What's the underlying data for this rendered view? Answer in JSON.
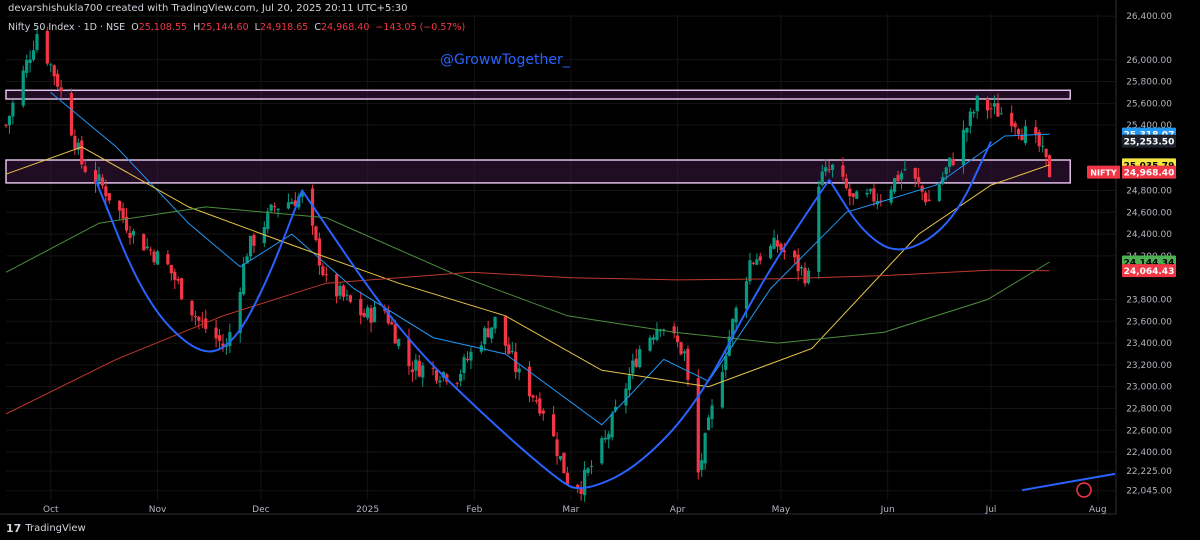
{
  "header": {
    "created_by": "devarshishukla700 created with TradingView.com, Jul 20, 2025 20:11 UTC+5:30"
  },
  "info": {
    "symbol": "Nifty 50 Index · 1D · NSE",
    "open_label": "O",
    "open": "25,108.55",
    "high_label": "H",
    "high": "25,144.60",
    "low_label": "L",
    "low": "24,918.65",
    "close_label": "C",
    "close": "24,968.40",
    "change": "−143.05 (−0.57%)"
  },
  "watermark": "@GrowwTogether_",
  "footer": {
    "logo_text": "TradingView",
    "logo_mark": "𝟭𝟳"
  },
  "colors": {
    "background": "#000000",
    "up": "#089981",
    "down": "#f23645",
    "zone_fill": "#3b1740",
    "zone_border": "#e1bee7",
    "ema_blue": "#2196f3",
    "ema_yellow": "#e8c547",
    "sma_green": "#4c8f3d",
    "sma_red": "#c0392b",
    "pattern_line": "#2962ff"
  },
  "chart_data": {
    "type": "candlestick",
    "y_range": [
      21960,
      26420
    ],
    "x_range": [
      "2024-09-18",
      "2025-08-06"
    ],
    "y_ticks": [
      "26,400.00",
      "26,000.00",
      "25,800.00",
      "25,600.00",
      "25,400.00",
      "24,800.00",
      "24,600.00",
      "24,400.00",
      "24,200.00",
      "23,800.00",
      "23,600.00",
      "23,400.00",
      "23,200.00",
      "23,000.00",
      "22,800.00",
      "22,600.00",
      "22,400.00",
      "22,225.00",
      "22,045.00"
    ],
    "y_tick_values": [
      26400,
      26000,
      25800,
      25600,
      25400,
      24800,
      24600,
      24400,
      24200,
      23800,
      23600,
      23400,
      23200,
      23000,
      22800,
      22600,
      22400,
      22225,
      22045
    ],
    "x_ticks": [
      {
        "label": "Oct",
        "date": "2024-10-01"
      },
      {
        "label": "Nov",
        "date": "2024-11-01"
      },
      {
        "label": "Dec",
        "date": "2024-12-01"
      },
      {
        "label": "2025",
        "date": "2025-01-01"
      },
      {
        "label": "Feb",
        "date": "2025-02-01"
      },
      {
        "label": "Mar",
        "date": "2025-03-01"
      },
      {
        "label": "Apr",
        "date": "2025-04-01"
      },
      {
        "label": "May",
        "date": "2025-05-01"
      },
      {
        "label": "Jun",
        "date": "2025-06-01"
      },
      {
        "label": "Jul",
        "date": "2025-07-01"
      },
      {
        "label": "Aug",
        "date": "2025-08-01"
      }
    ],
    "anchors": [
      [
        "2024-09-18",
        25400
      ],
      [
        "2024-09-27",
        26250
      ],
      [
        "2024-10-03",
        25800
      ],
      [
        "2024-10-10",
        25050
      ],
      [
        "2024-10-17",
        24800
      ],
      [
        "2024-10-25",
        24400
      ],
      [
        "2024-11-04",
        24100
      ],
      [
        "2024-11-13",
        23600
      ],
      [
        "2024-11-21",
        23350
      ],
      [
        "2024-11-27",
        24250
      ],
      [
        "2024-12-05",
        24650
      ],
      [
        "2024-12-13",
        24750
      ],
      [
        "2024-12-20",
        23950
      ],
      [
        "2024-12-31",
        23650
      ],
      [
        "2025-01-06",
        23700
      ],
      [
        "2025-01-13",
        23200
      ],
      [
        "2025-01-27",
        23100
      ],
      [
        "2025-02-03",
        23450
      ],
      [
        "2025-02-07",
        23600
      ],
      [
        "2025-02-14",
        23100
      ],
      [
        "2025-02-21",
        22800
      ],
      [
        "2025-02-28",
        22150
      ],
      [
        "2025-03-04",
        22100
      ],
      [
        "2025-03-11",
        22500
      ],
      [
        "2025-03-21",
        23350
      ],
      [
        "2025-03-27",
        23600
      ],
      [
        "2025-04-03",
        23300
      ],
      [
        "2025-04-07",
        22200
      ],
      [
        "2025-04-15",
        23350
      ],
      [
        "2025-04-22",
        24150
      ],
      [
        "2025-04-30",
        24300
      ],
      [
        "2025-05-09",
        24000
      ],
      [
        "2025-05-12",
        24900
      ],
      [
        "2025-05-16",
        25000
      ],
      [
        "2025-05-22",
        24700
      ],
      [
        "2025-05-30",
        24750
      ],
      [
        "2025-06-06",
        25000
      ],
      [
        "2025-06-13",
        24700
      ],
      [
        "2025-06-20",
        25100
      ],
      [
        "2025-06-27",
        25600
      ],
      [
        "2025-07-01",
        25550
      ],
      [
        "2025-07-07",
        25480
      ],
      [
        "2025-07-10",
        25350
      ],
      [
        "2025-07-15",
        25200
      ],
      [
        "2025-07-18",
        24968
      ]
    ],
    "zones": [
      {
        "y_top": 25720,
        "y_bottom": 25640,
        "from": "2024-09-18",
        "to": "2025-07-24"
      },
      {
        "y_top": 25080,
        "y_bottom": 24870,
        "from": "2024-09-18",
        "to": "2025-07-24"
      }
    ],
    "moving_averages": [
      {
        "color": "ema_blue",
        "points": [
          [
            "2024-10-01",
            25700
          ],
          [
            "2024-10-20",
            25200
          ],
          [
            "2024-11-10",
            24500
          ],
          [
            "2024-11-25",
            24100
          ],
          [
            "2024-12-10",
            24400
          ],
          [
            "2024-12-28",
            23900
          ],
          [
            "2025-01-20",
            23450
          ],
          [
            "2025-02-10",
            23300
          ],
          [
            "2025-03-10",
            22650
          ],
          [
            "2025-03-28",
            23250
          ],
          [
            "2025-04-10",
            23050
          ],
          [
            "2025-04-28",
            23900
          ],
          [
            "2025-05-20",
            24600
          ],
          [
            "2025-06-15",
            24850
          ],
          [
            "2025-07-05",
            25300
          ],
          [
            "2025-07-18",
            25318.07
          ]
        ]
      },
      {
        "color": "ema_yellow",
        "points": [
          [
            "2024-09-18",
            24950
          ],
          [
            "2024-10-10",
            25200
          ],
          [
            "2024-11-10",
            24650
          ],
          [
            "2024-12-10",
            24300
          ],
          [
            "2025-01-10",
            23950
          ],
          [
            "2025-02-10",
            23650
          ],
          [
            "2025-03-10",
            23150
          ],
          [
            "2025-04-10",
            23000
          ],
          [
            "2025-05-10",
            23350
          ],
          [
            "2025-06-10",
            24400
          ],
          [
            "2025-07-01",
            24850
          ],
          [
            "2025-07-18",
            25035.79
          ]
        ]
      },
      {
        "color": "sma_green",
        "points": [
          [
            "2024-09-18",
            24050
          ],
          [
            "2024-10-15",
            24500
          ],
          [
            "2024-11-15",
            24650
          ],
          [
            "2024-12-20",
            24550
          ],
          [
            "2025-01-25",
            24050
          ],
          [
            "2025-02-28",
            23650
          ],
          [
            "2025-03-31",
            23500
          ],
          [
            "2025-04-30",
            23400
          ],
          [
            "2025-05-31",
            23500
          ],
          [
            "2025-06-30",
            23800
          ],
          [
            "2025-07-18",
            24144.34
          ]
        ]
      },
      {
        "color": "sma_red",
        "points": [
          [
            "2024-09-18",
            22750
          ],
          [
            "2024-10-20",
            23250
          ],
          [
            "2024-11-20",
            23650
          ],
          [
            "2024-12-20",
            23950
          ],
          [
            "2025-01-31",
            24050
          ],
          [
            "2025-03-01",
            24000
          ],
          [
            "2025-04-01",
            23980
          ],
          [
            "2025-05-01",
            23990
          ],
          [
            "2025-06-01",
            24020
          ],
          [
            "2025-07-01",
            24070
          ],
          [
            "2025-07-18",
            24064.43
          ]
        ]
      }
    ],
    "cup_lines": [
      [
        [
          "2024-10-14",
          24900
        ],
        [
          "2024-10-28",
          23800
        ],
        [
          "2024-11-12",
          23300
        ],
        [
          "2024-11-22",
          23350
        ],
        [
          "2024-12-02",
          23900
        ],
        [
          "2024-12-13",
          24800
        ]
      ],
      [
        [
          "2024-12-13",
          24800
        ],
        [
          "2025-01-10",
          23500
        ],
        [
          "2025-02-05",
          22700
        ],
        [
          "2025-02-25",
          22150
        ],
        [
          "2025-03-04",
          22030
        ],
        [
          "2025-03-20",
          22250
        ],
        [
          "2025-04-07",
          22850
        ],
        [
          "2025-04-25",
          23950
        ],
        [
          "2025-05-15",
          24900
        ]
      ],
      [
        [
          "2025-05-15",
          24900
        ],
        [
          "2025-05-25",
          24400
        ],
        [
          "2025-06-05",
          24200
        ],
        [
          "2025-06-20",
          24500
        ],
        [
          "2025-07-01",
          25250
        ]
      ],
      [
        [
          "2025-07-10",
          22050
        ],
        [
          "2025-08-06",
          22200
        ]
      ]
    ],
    "price_labels": [
      {
        "text": "25,318.07",
        "value": 25318.07,
        "color": "#2196f3"
      },
      {
        "text": "25,253.50",
        "value": 25253.5,
        "color": "#1e222d"
      },
      {
        "text": "25,035.79",
        "value": 25035.79,
        "color": "#f5e642",
        "text_color": "#000000"
      },
      {
        "text": "24,968.40",
        "value": 24968.4,
        "color": "#f23645",
        "tag": "NIFTY"
      },
      {
        "text": "24,144.34",
        "value": 24144.34,
        "color": "#4caf50",
        "text_color": "#000000"
      },
      {
        "text": "24,064.43",
        "value": 24064.43,
        "color": "#f23645"
      }
    ]
  }
}
